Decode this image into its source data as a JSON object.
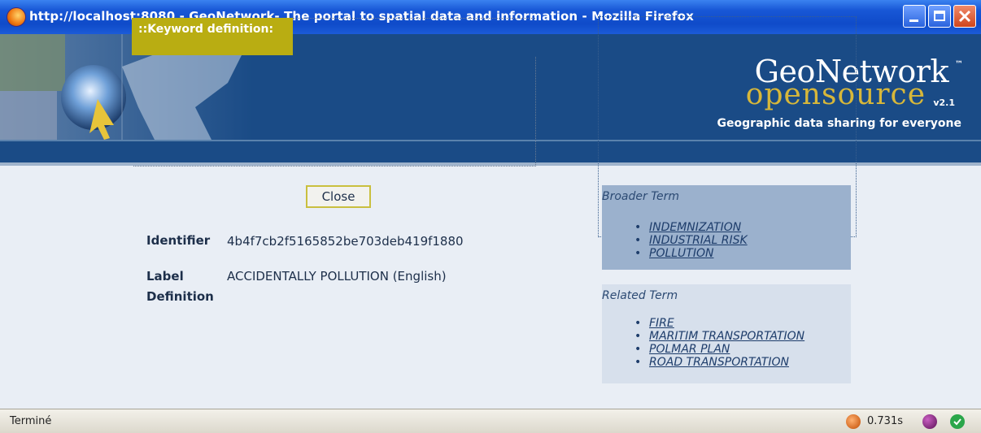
{
  "window": {
    "title": "http://localhost:8080 - GeoNetwork- The portal to spatial data and information - Mozilla Firefox"
  },
  "banner": {
    "logo_name": "GeoNetwork",
    "logo_tm": "™",
    "logo_open": "opensource",
    "logo_version": "v2.1",
    "tagline": "Geographic data sharing for everyone"
  },
  "keyword": {
    "header": "::Keyword definition:",
    "identifier_label": "Identifier",
    "identifier_value": "4b4f7cb2f5165852be703deb419f1880",
    "label_label": "Label",
    "label_value": "ACCIDENTALLY POLLUTION (English)",
    "definition_label": "Definition",
    "close_label": "Close"
  },
  "broader": {
    "title": "Broader Term",
    "terms": [
      "INDEMNIZATION",
      "INDUSTRIAL RISK",
      "POLLUTION"
    ]
  },
  "related": {
    "title": "Related Term",
    "terms": [
      "FIRE",
      "MARITIM TRANSPORTATION",
      "POLMAR PLAN",
      "ROAD TRANSPORTATION"
    ]
  },
  "status": {
    "text": "Terminé",
    "time": "0.731s"
  },
  "colors": {
    "banner": "#1a4b86",
    "header_accent": "#b9ad12",
    "broader_bg": "#9bb1cd",
    "related_bg": "#d7e0ec"
  }
}
